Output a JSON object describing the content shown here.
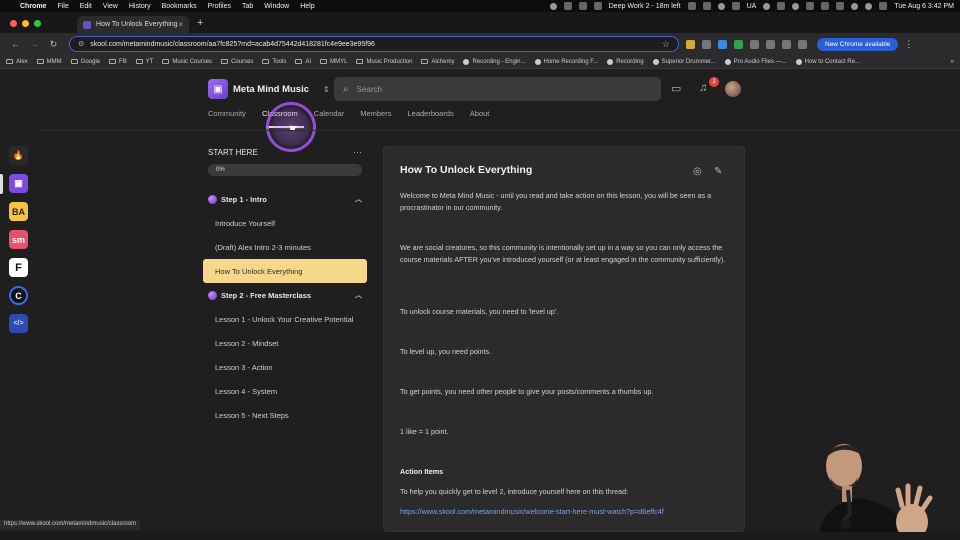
{
  "menubar": {
    "app": "Chrome",
    "items": [
      "File",
      "Edit",
      "View",
      "History",
      "Bookmarks",
      "Profiles",
      "Tab",
      "Window",
      "Help"
    ],
    "status_text": "Deep Work 2 - 18m left",
    "input_source": "UA",
    "clock": "Tue Aug 6  3:42 PM"
  },
  "browser": {
    "tab_title": "How To Unlock Everything",
    "url": "skool.com/metamindmusic/classroom/aa7fc825?md=acab4d75442d418281fc4e9ee3e95f96",
    "new_chrome_label": "New Chrome available",
    "bookmarks": [
      "Alex",
      "MMM",
      "Google",
      "FB",
      "YT",
      "Music Courses",
      "Courses",
      "Tools",
      "AI",
      "MMYL",
      "Music Production",
      "Alchemy",
      "Recording - Engin...",
      "Home Recording F...",
      "Recording",
      "Superior Drummer...",
      "Pro Audio Files —...",
      "How to Contact Re..."
    ],
    "status_url": "https://www.skool.com/metamindmusic/classroom"
  },
  "rail": {
    "apps": [
      {
        "name": "flame-app",
        "glyph": "🔥",
        "bg": "#2a2a2a"
      },
      {
        "name": "meta-mind-music-app",
        "glyph": "▣",
        "bg": "#7c4ce0"
      },
      {
        "name": "ba-app",
        "glyph": "BA",
        "bg": "#f6c344"
      },
      {
        "name": "sm-app",
        "glyph": "sm",
        "bg": "#e8506d"
      },
      {
        "name": "f-app",
        "glyph": "F",
        "bg": "#ffffff"
      },
      {
        "name": "c-app",
        "glyph": "C",
        "bg": "#1a1a1a"
      },
      {
        "name": "code-app",
        "glyph": "</>",
        "bg": "#2d4bb0"
      }
    ]
  },
  "community": {
    "name": "Meta Mind Music",
    "search_placeholder": "Search",
    "notification_count": "1",
    "tabs": [
      "Community",
      "Classroom",
      "Calendar",
      "Members",
      "Leaderboards",
      "About"
    ],
    "active_tab": "Classroom"
  },
  "course": {
    "title": "START HERE",
    "progress_label": "0%",
    "progress": 0,
    "sections": [
      {
        "label": "Step 1 - Intro",
        "lessons": [
          "Introduce Yourself",
          "(Draft) Alex Intro 2-3 minutes",
          "How To Unlock Everything"
        ]
      },
      {
        "label": "Step 2 - Free Masterclass",
        "lessons": [
          "Lesson 1 - Unlock Your Creative Potential",
          "Lesson 2 - Mindset",
          "Lesson 3 - Action",
          "Lesson 4 - System",
          "Lesson 5 - Next Steps"
        ]
      }
    ],
    "current_lesson": "How To Unlock Everything"
  },
  "lesson": {
    "title": "How To Unlock Everything",
    "paragraphs": [
      "Welcome to Meta Mind Music - until you read and take action on this lesson, you will be seen as a procrastinator in our community.",
      "We are social creatures, so this community is intentionally set up in a way so you can only access the course materials AFTER you've introduced yourself (or at least engaged in the community sufficiently).",
      "To unlock course materials, you need to 'level up'.",
      "To level up, you need points.",
      "To get points, you need other people to give your posts/comments a thumbs up.",
      "1 like = 1 point."
    ],
    "action_heading": "Action Items",
    "action_text": "To help you quickly get to level 2, introduce yourself here on this thread:",
    "action_link": "https://www.skool.com/metamindmusic/welcome-start-here-must-watch?p=d6effc4f"
  }
}
